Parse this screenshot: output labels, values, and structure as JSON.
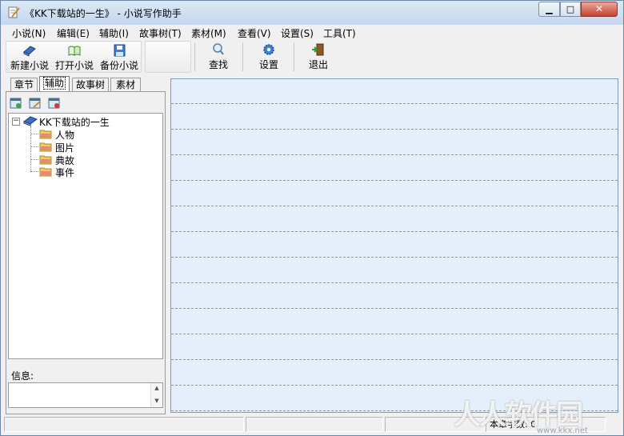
{
  "window": {
    "title": "《KK下载站的一生》 - 小说写作助手",
    "controls": {
      "minimize": "▁",
      "maximize": "□",
      "close": "✕"
    }
  },
  "menu": [
    "小说(N)",
    "编辑(E)",
    "辅助(I)",
    "故事树(T)",
    "素材(M)",
    "查看(V)",
    "设置(S)",
    "工具(T)"
  ],
  "toolbar": {
    "new_novel": "新建小说",
    "open_novel": "打开小说",
    "backup_novel": "备份小说",
    "find": "查找",
    "settings": "设置",
    "exit": "退出"
  },
  "left_panel": {
    "tabs": [
      "章节",
      "辅助",
      "故事树",
      "素材"
    ],
    "active_tab": "辅助",
    "tree": {
      "root": "KK下载站的一生",
      "children": [
        "人物",
        "图片",
        "典故",
        "事件"
      ]
    },
    "info_label": "信息:",
    "info_value": ""
  },
  "status": {
    "cell1": "",
    "cell2": "",
    "cell3": "",
    "word_count_label": "本章字数: 0"
  },
  "watermark": {
    "text": "人人软件园",
    "sub": "www.kkx.net"
  },
  "colors": {
    "editor_bg": "#e4effb",
    "titlebar": "#c4d7ee"
  }
}
